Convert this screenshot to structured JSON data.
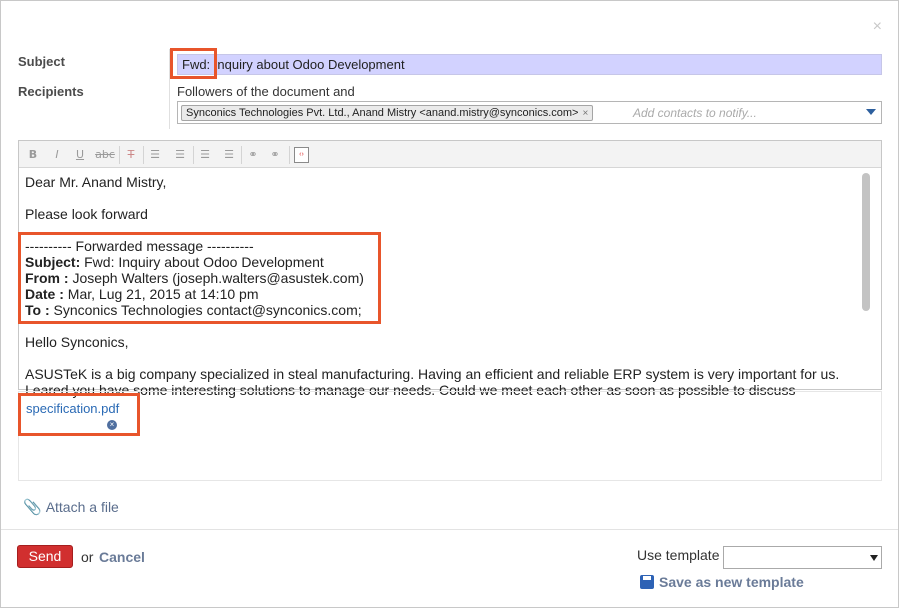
{
  "dialog": {
    "close_glyph": "×"
  },
  "labels": {
    "subject": "Subject",
    "recipients": "Recipients"
  },
  "subject": {
    "value": "Fwd: Inquiry about Odoo Development",
    "highlight_color": "#d2d2ff"
  },
  "recipients": {
    "followers_text": "Followers of the document and",
    "tag": "Synconics Technologies Pvt. Ltd., Anand Mistry <anand.mistry@synconics.com>",
    "tag_remove": "×",
    "placeholder": "Add contacts to notify..."
  },
  "toolbar": {
    "bold": "B",
    "italic": "I",
    "underline": "U",
    "strike": "abc",
    "clear_format": "T",
    "bullet_list": "☰",
    "numbered_list": "☰",
    "outdent": "☰",
    "indent": "☰",
    "link": "⚭",
    "unlink": "⚭",
    "source": "‹›"
  },
  "body": {
    "greeting": "Dear Mr. Anand Mistry,",
    "line1": "Please look forward",
    "fwd_header": "---------- Forwarded message ----------",
    "fwd_subject_label": "Subject:",
    "fwd_subject": " Fwd: Inquiry about Odoo Development",
    "fwd_from_label": "From :",
    "fwd_from": " Joseph Walters (joseph.walters@asustek.com)",
    "fwd_date_label": "Date :",
    "fwd_date": " Mar, Lug 21, 2015 at 14:10 pm",
    "fwd_to_label": "To :",
    "fwd_to": " Synconics Technologies contact@synconics.com;",
    "hello": "Hello Synconics,",
    "para_line1": "ASUSTeK is a big company specialized in steal manufacturing. Having an efficient and reliable ERP system is very important for us.",
    "para_line2": "I eared you have some interesting solutions to manage our needs. Could we meet each other as soon as possible to discuss"
  },
  "attachments": [
    {
      "name": "specification.pdf",
      "remove_glyph": "×"
    }
  ],
  "actions": {
    "attach_file": "Attach a file",
    "send": "Send",
    "or": "or",
    "cancel": "Cancel",
    "use_template": "Use template",
    "template_value": "",
    "save_template": "Save as new template"
  },
  "colors": {
    "accent_highlight": "#e8552b",
    "send": "#d12f2f",
    "link": "#2a6ab5"
  }
}
